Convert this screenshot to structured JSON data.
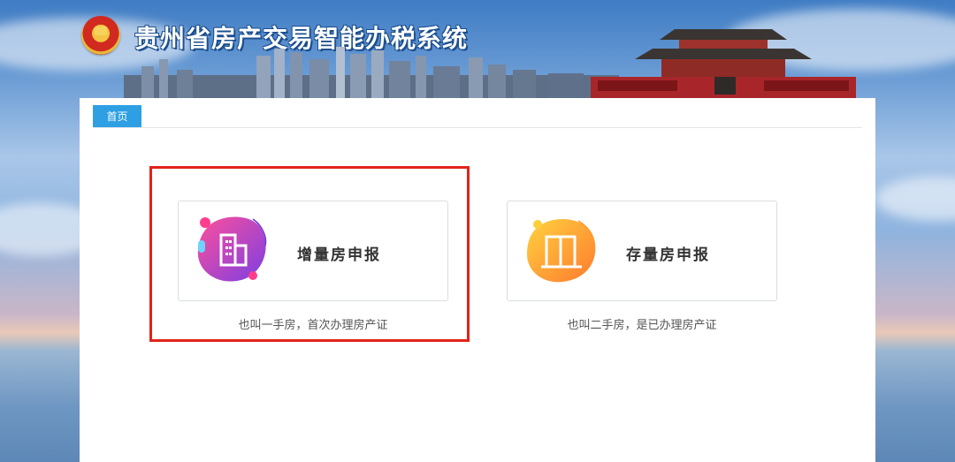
{
  "header": {
    "title": "贵州省房产交易智能办税系统",
    "emblem_icon": "national-emblem-icon"
  },
  "tabs": [
    {
      "label": "首页",
      "active": true
    }
  ],
  "cards": [
    {
      "label": "增量房申报",
      "description": "也叫一手房，首次办理房产证",
      "icon": "building-icon",
      "highlighted": true
    },
    {
      "label": "存量房申报",
      "description": "也叫二手房，是已办理房产证",
      "icon": "door-icon",
      "highlighted": false
    }
  ],
  "colors": {
    "tab_active": "#2e9fe3",
    "highlight_border": "#e2231a",
    "card_new_gradient": [
      "#ff4f9a",
      "#7b3fe4"
    ],
    "card_old_gradient": [
      "#ffd23f",
      "#ff7a2e"
    ]
  }
}
